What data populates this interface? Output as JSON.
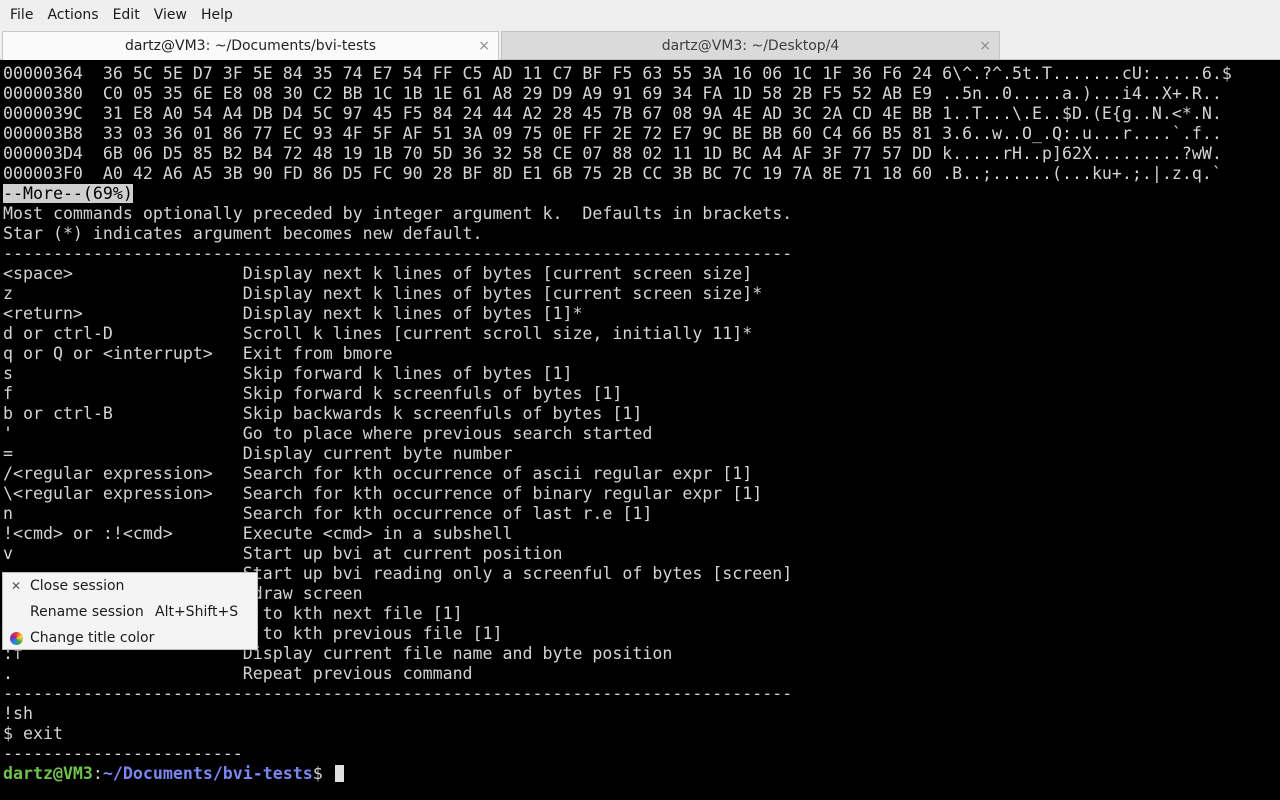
{
  "menubar": {
    "items": [
      "File",
      "Actions",
      "Edit",
      "View",
      "Help"
    ]
  },
  "tabs": [
    {
      "title": "dartz@VM3: ~/Documents/bvi-tests",
      "close": "×"
    },
    {
      "title": "dartz@VM3: ~/Desktop/4",
      "close": "×"
    }
  ],
  "terminal": {
    "lines": [
      "00000364  36 5C 5E D7 3F 5E 84 35 74 E7 54 FF C5 AD 11 C7 BF F5 63 55 3A 16 06 1C 1F 36 F6 24 6\\^.?^.5t.T.......cU:.....6.$",
      "00000380  C0 05 35 6E E8 08 30 C2 BB 1C 1B 1E 61 A8 29 D9 A9 91 69 34 FA 1D 58 2B F5 52 AB E9 ..5n..0.....a.)...i4..X+.R..",
      "0000039C  31 E8 A0 54 A4 DB D4 5C 97 45 F5 84 24 44 A2 28 45 7B 67 08 9A 4E AD 3C 2A CD 4E BB 1..T...\\.E..$D.(E{g..N.<*.N.",
      "000003B8  33 03 36 01 86 77 EC 93 4F 5F AF 51 3A 09 75 0E FF 2E 72 E7 9C BE BB 60 C4 66 B5 81 3.6..w..O_.Q:.u...r....`.f..",
      "000003D4  6B 06 D5 85 B2 B4 72 48 19 1B 70 5D 36 32 58 CE 07 88 02 11 1D BC A4 AF 3F 77 57 DD k.....rH..p]62X.........?wW.",
      "000003F0  A0 42 A6 A5 3B 90 FD 86 D5 FC 90 28 BF 8D E1 6B 75 2B CC 3B BC 7C 19 7A 8E 71 18 60 .B..;......(...ku+.;.|.z.q.`",
      "__MORE__",
      "Most commands optionally preceded by integer argument k.  Defaults in brackets.",
      "Star (*) indicates argument becomes new default.",
      "-------------------------------------------------------------------------------",
      "<space>                 Display next k lines of bytes [current screen size]",
      "z                       Display next k lines of bytes [current screen size]*",
      "<return>                Display next k lines of bytes [1]*",
      "d or ctrl-D             Scroll k lines [current scroll size, initially 11]*",
      "q or Q or <interrupt>   Exit from bmore",
      "s                       Skip forward k lines of bytes [1]",
      "f                       Skip forward k screenfuls of bytes [1]",
      "b or ctrl-B             Skip backwards k screenfuls of bytes [1]",
      "'                       Go to place where previous search started",
      "=                       Display current byte number",
      "/<regular expression>   Search for kth occurrence of ascii regular expr [1]",
      "\\<regular expression>   Search for kth occurrence of binary regular expr [1]",
      "n                       Search for kth occurrence of last r.e [1]",
      "!<cmd> or :!<cmd>       Execute <cmd> in a subshell",
      "v                       Start up bvi at current position",
      "                        Start up bvi reading only a screenful of bytes [screen]",
      "                         draw screen",
      "                          to kth next file [1]",
      "                          to kth previous file [1]",
      ":f                      Display current file name and byte position",
      ".                       Repeat previous command",
      "-------------------------------------------------------------------------------",
      "!sh",
      "$ exit",
      "------------------------"
    ],
    "more_prompt": "--More--(69%)",
    "prompt": {
      "user": "dartz@VM3",
      "colon": ":",
      "path": "~/Documents/bvi-tests",
      "symbol": "$ "
    }
  },
  "context_menu": {
    "items": [
      {
        "label": "Close session",
        "shortcut": "",
        "icon": "close-icon"
      },
      {
        "label": "Rename session",
        "shortcut": "Alt+Shift+S",
        "icon": ""
      },
      {
        "label": "Change title color",
        "shortcut": "",
        "icon": "color-wheel-icon"
      }
    ]
  }
}
